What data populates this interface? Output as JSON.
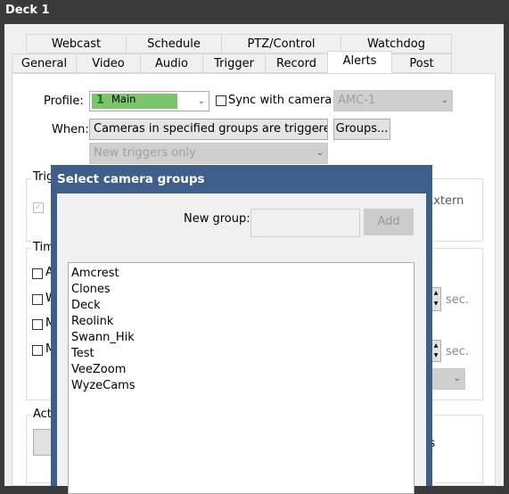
{
  "window": {
    "title": "Deck 1"
  },
  "tabs_row1": [
    "Webcast",
    "Schedule",
    "PTZ/Control",
    "Watchdog"
  ],
  "tabs_row2": [
    "General",
    "Video",
    "Audio",
    "Trigger",
    "Record",
    "Alerts",
    "Post"
  ],
  "active_tab": "Alerts",
  "profile": {
    "label": "Profile:",
    "value": "Main",
    "number": "1",
    "color": "#7ac46a"
  },
  "sync": {
    "label": "Sync with camera",
    "checked": false,
    "camera": "AMC-1"
  },
  "when": {
    "label": "When:",
    "value": "Cameras in specified groups are triggerec",
    "groups_button": "Groups...",
    "sub_value": "New triggers only"
  },
  "background": {
    "trigger_group_title": "Trig",
    "extern_text": "Extern",
    "time_group_title": "Tim",
    "time_checks": [
      "A",
      "W",
      "M",
      "M"
    ],
    "sec_label": "sec.",
    "actions_group_title": "Act",
    "actions_text": "rs"
  },
  "dialog": {
    "title": "Select camera groups",
    "new_group_label": "New group:",
    "new_group_value": "",
    "add_button": "Add",
    "groups": [
      "Amcrest",
      "Clones",
      "Deck",
      "Reolink",
      "Swann_Hik",
      "Test",
      "VeeZoom",
      "WyzeCams"
    ]
  }
}
